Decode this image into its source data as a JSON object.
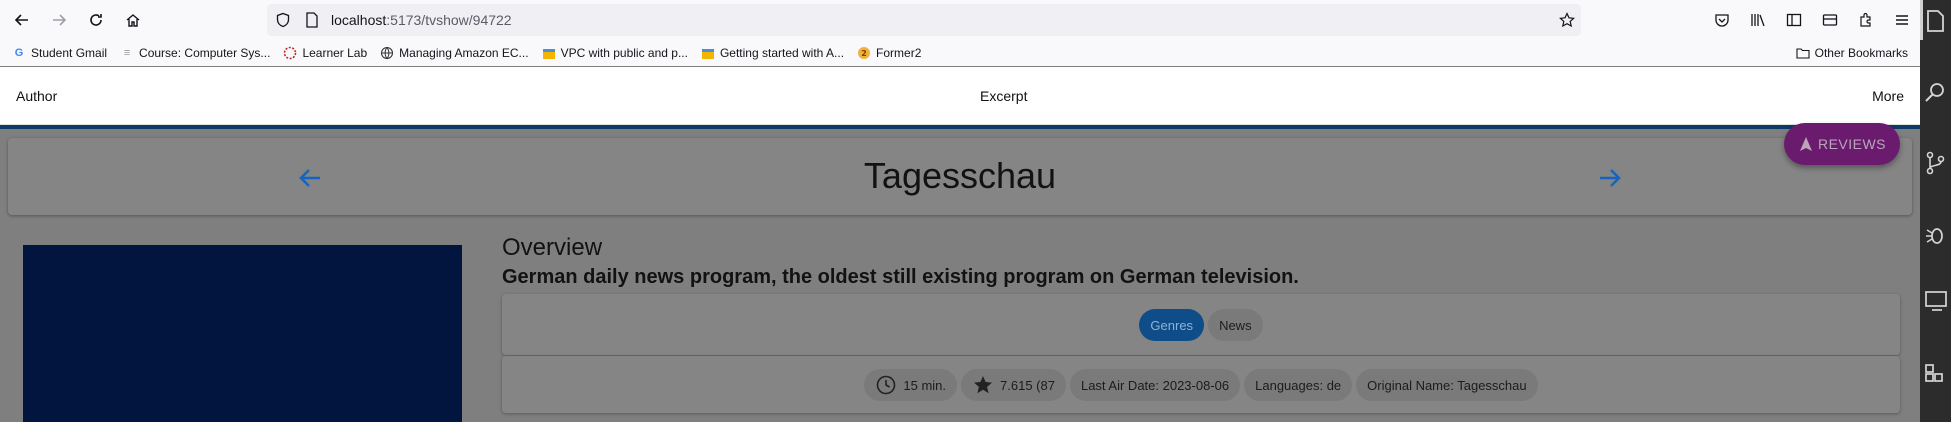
{
  "browser": {
    "url_host": "localhost",
    "url_path": ":5173/tvshow/94722"
  },
  "bookmarks": [
    {
      "label": "Student Gmail",
      "icon": "google-icon"
    },
    {
      "label": "Course: Computer Sys...",
      "icon": "course-icon"
    },
    {
      "label": "Learner Lab",
      "icon": "learner-lab-icon"
    },
    {
      "label": "Managing Amazon EC...",
      "icon": "globe-icon"
    },
    {
      "label": "VPC with public and p...",
      "icon": "aws-box-icon"
    },
    {
      "label": "Getting started with A...",
      "icon": "aws-box-icon"
    },
    {
      "label": "Former2",
      "icon": "former2-icon"
    }
  ],
  "other_bookmarks": "Other Bookmarks",
  "header": {
    "author": "Author",
    "excerpt": "Excerpt",
    "more": "More"
  },
  "show": {
    "title": "Tagesschau",
    "reviews_label": "REVIEWS",
    "overview_heading": "Overview",
    "overview_text": "German daily news program, the oldest still existing program on German television.",
    "genres_label": "Genres",
    "genres": [
      "News"
    ],
    "runtime": "15 min.",
    "rating": "7.615 (87",
    "last_air_date": "Last Air Date: 2023-08-06",
    "languages": "Languages: de",
    "original_name": "Original Name: Tagesschau"
  },
  "colors": {
    "accent_blue": "#1565c0",
    "reviews_purple": "#6a1b6e",
    "poster_navy": "#01153e"
  }
}
